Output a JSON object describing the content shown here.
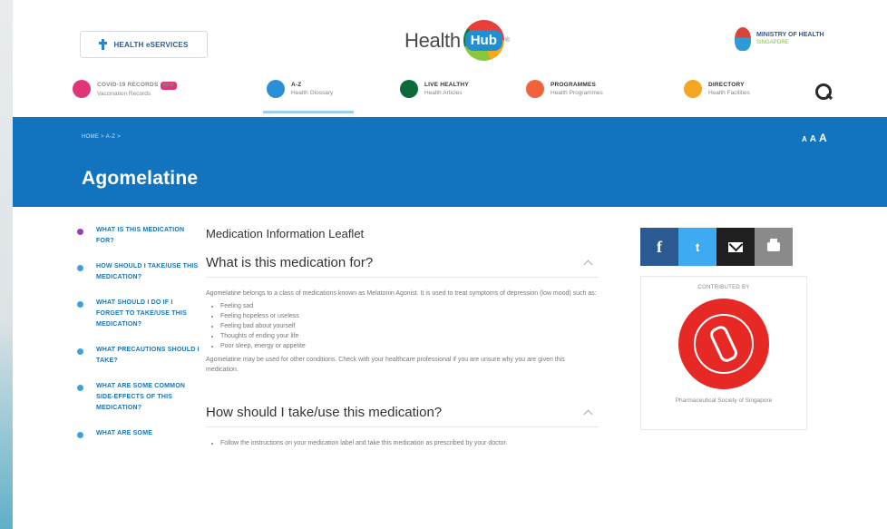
{
  "header": {
    "eservices_label": "HEALTH eSERVICES",
    "logo_text": "Health",
    "logo_badge": "Hub",
    "logo_mark": "®",
    "moh_title": "MINISTRY OF HEALTH",
    "moh_sub": "SINGAPORE"
  },
  "nav": {
    "items": [
      {
        "title": "COVID-19 RECORDS",
        "badge": "NEW",
        "sub": "Vaccination Records",
        "color": "#e0357b"
      },
      {
        "title": "A-Z",
        "sub": "Health Glossary",
        "color": "#2a8fd6"
      },
      {
        "title": "LIVE HEALTHY",
        "sub": "Health Articles",
        "color": "#0b6a3a"
      },
      {
        "title": "PROGRAMMES",
        "sub": "Health Programmes",
        "color": "#f0623a"
      },
      {
        "title": "DIRECTORY",
        "sub": "Health Facilities",
        "color": "#f5a623"
      }
    ]
  },
  "banner": {
    "breadcrumb": "HOME > A-Z >",
    "text_size": [
      "A",
      "A",
      "A"
    ],
    "title": "Agomelatine",
    "color": "#1274bf"
  },
  "toc": [
    "WHAT IS THIS MEDICATION FOR?",
    "HOW SHOULD I TAKE/USE THIS MEDICATION?",
    "WHAT SHOULD I DO IF I FORGET TO TAKE/USE THIS MEDICATION?",
    "WHAT PRECAUTIONS SHOULD I TAKE?",
    "WHAT ARE SOME COMMON SIDE-EFFECTS OF THIS MEDICATION?",
    "WHAT ARE SOME"
  ],
  "main": {
    "leaflet_title": "Medication Information Leaflet",
    "section1": {
      "heading": "What is this medication for?",
      "intro": "Agomelatine belongs to a class of medications known as Melatonin Agonist. It is used to treat symptoms of depression (low mood) such as:",
      "bullets": [
        "Feeling sad",
        "Feeling hopeless or useless",
        "Feeling bad about yourself",
        "Thoughts of ending your life",
        "Poor sleep, energy or appetite"
      ],
      "outro": "Agomelatine may be used for other conditions. Check with your healthcare professional if you are unsure why you are given this medication."
    },
    "section2": {
      "heading": "How should I take/use this medication?",
      "bullet": "Follow the instructions on your medication label and take this medication as prescribed by your doctor."
    }
  },
  "share": {
    "facebook": "f",
    "twitter": "t"
  },
  "contributor": {
    "label": "CONTRIBUTED BY",
    "org": "Pharmaceutical Society of Singapore"
  }
}
